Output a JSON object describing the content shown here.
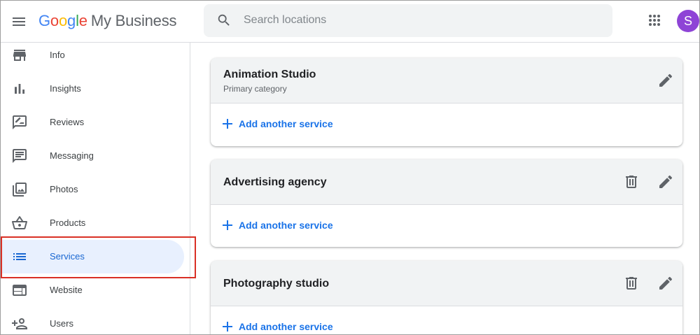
{
  "header": {
    "logo_google": [
      "G",
      "o",
      "o",
      "g",
      "l",
      "e"
    ],
    "logo_product": "My Business",
    "search_placeholder": "Search locations",
    "avatar_initial": "S",
    "avatar_color": "#8e44d6"
  },
  "sidebar": {
    "items": [
      {
        "label": "Info",
        "icon": "storefront-icon"
      },
      {
        "label": "Insights",
        "icon": "bar-chart-icon"
      },
      {
        "label": "Reviews",
        "icon": "rate-review-icon"
      },
      {
        "label": "Messaging",
        "icon": "message-icon"
      },
      {
        "label": "Photos",
        "icon": "photo-library-icon"
      },
      {
        "label": "Products",
        "icon": "shopping-basket-icon"
      },
      {
        "label": "Services",
        "icon": "list-icon",
        "active": true
      },
      {
        "label": "Website",
        "icon": "web-icon"
      },
      {
        "label": "Users",
        "icon": "person-add-icon"
      }
    ]
  },
  "main": {
    "cards": [
      {
        "title": "Animation Studio",
        "subtitle": "Primary category",
        "add_label": "Add another service",
        "deletable": false
      },
      {
        "title": "Advertising agency",
        "subtitle": "",
        "add_label": "Add another service",
        "deletable": true
      },
      {
        "title": "Photography studio",
        "subtitle": "",
        "add_label": "Add another service",
        "deletable": true
      }
    ]
  },
  "colors": {
    "accent": "#1a73e8",
    "active_nav_bg": "#e8f0fe",
    "highlight_border": "#d93025"
  }
}
